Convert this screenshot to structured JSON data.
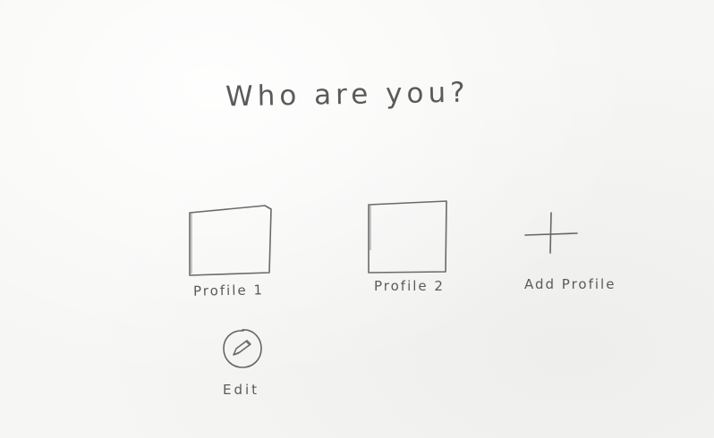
{
  "screen": {
    "title": "Who are you?"
  },
  "profiles": [
    {
      "label": "Profile 1"
    },
    {
      "label": "Profile 2"
    }
  ],
  "add_profile": {
    "label": "Add Profile",
    "icon": "plus-icon"
  },
  "edit": {
    "label": "Edit",
    "icon": "pencil-icon"
  },
  "colors": {
    "pencil": "#5e5e5e",
    "paper": "#f6f6f4"
  }
}
